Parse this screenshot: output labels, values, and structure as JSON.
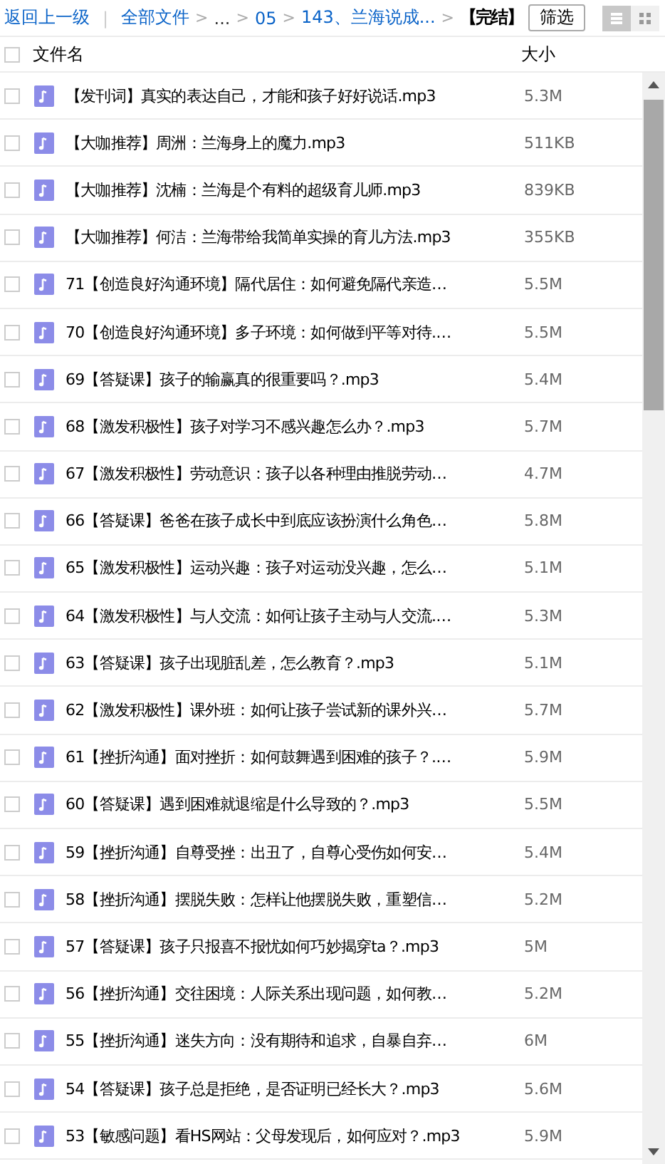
{
  "toolbar": {
    "back": "返回上一级",
    "separator": "|",
    "breadcrumb": [
      {
        "label": "全部文件",
        "kind": "link"
      },
      {
        "label": ">",
        "kind": "sep"
      },
      {
        "label": "...",
        "kind": "text"
      },
      {
        "label": ">",
        "kind": "sep"
      },
      {
        "label": "05",
        "kind": "link"
      },
      {
        "label": ">",
        "kind": "sep"
      },
      {
        "label": "143、兰海说成...",
        "kind": "link"
      },
      {
        "label": ">",
        "kind": "sep"
      },
      {
        "label": "【完结】",
        "kind": "current"
      }
    ],
    "filter_button": "筛选",
    "views": [
      {
        "kind": "list",
        "selected": true
      },
      {
        "kind": "grid",
        "selected": false
      }
    ]
  },
  "table": {
    "columns": [
      "文件名",
      "大小"
    ],
    "select_all": false,
    "rows": [
      {
        "name": "【发刊词】真实的表达自己，才能和孩子好好说话.mp3",
        "size": "5.3M",
        "checked": false
      },
      {
        "name": "【大咖推荐】周洲：兰海身上的魔力.mp3",
        "size": "511KB",
        "checked": false
      },
      {
        "name": "【大咖推荐】沈楠：兰海是个有料的超级育儿师.mp3",
        "size": "839KB",
        "checked": false
      },
      {
        "name": "【大咖推荐】何洁：兰海带给我简单实操的育儿方法.mp3",
        "size": "355KB",
        "checked": false
      },
      {
        "name": "71【创造良好沟通环境】隔代居住：如何避免隔代亲造…",
        "size": "5.5M",
        "checked": false
      },
      {
        "name": "70【创造良好沟通环境】多子环境：如何做到平等对待.…",
        "size": "5.5M",
        "checked": false
      },
      {
        "name": "69【答疑课】孩子的输赢真的很重要吗？.mp3",
        "size": "5.4M",
        "checked": false
      },
      {
        "name": "68【激发积极性】孩子对学习不感兴趣怎么办？.mp3",
        "size": "5.7M",
        "checked": false
      },
      {
        "name": "67【激发积极性】劳动意识：孩子以各种理由推脱劳动…",
        "size": "4.7M",
        "checked": false
      },
      {
        "name": "66【答疑课】爸爸在孩子成长中到底应该扮演什么角色…",
        "size": "5.8M",
        "checked": false
      },
      {
        "name": "65【激发积极性】运动兴趣：孩子对运动没兴趣，怎么…",
        "size": "5.1M",
        "checked": false
      },
      {
        "name": "64【激发积极性】与人交流：如何让孩子主动与人交流.…",
        "size": "5.3M",
        "checked": false
      },
      {
        "name": "63【答疑课】孩子出现脏乱差，怎么教育？.mp3",
        "size": "5.1M",
        "checked": false
      },
      {
        "name": "62【激发积极性】课外班：如何让孩子尝试新的课外兴…",
        "size": "5.7M",
        "checked": false
      },
      {
        "name": "61【挫折沟通】面对挫折：如何鼓舞遇到困难的孩子？.…",
        "size": "5.9M",
        "checked": false
      },
      {
        "name": "60【答疑课】遇到困难就退缩是什么导致的？.mp3",
        "size": "5.5M",
        "checked": false
      },
      {
        "name": "59【挫折沟通】自尊受挫：出丑了，自尊心受伤如何安…",
        "size": "5.4M",
        "checked": false
      },
      {
        "name": "58【挫折沟通】摆脱失败：怎样让他摆脱失败，重塑信…",
        "size": "5.2M",
        "checked": false
      },
      {
        "name": "57【答疑课】孩子只报喜不报忧如何巧妙揭穿ta？.mp3",
        "size": "5M",
        "checked": false
      },
      {
        "name": "56【挫折沟通】交往困境：人际关系出现问题，如何教…",
        "size": "5.2M",
        "checked": false
      },
      {
        "name": "55【挫折沟通】迷失方向：没有期待和追求，自暴自弃…",
        "size": "6M",
        "checked": false
      },
      {
        "name": "54【答疑课】孩子总是拒绝，是否证明已经长大？.mp3",
        "size": "5.6M",
        "checked": false
      },
      {
        "name": "53【敏感问题】看HS网站：父母发现后，如何应对？.mp3",
        "size": "5.9M",
        "checked": false
      }
    ]
  }
}
